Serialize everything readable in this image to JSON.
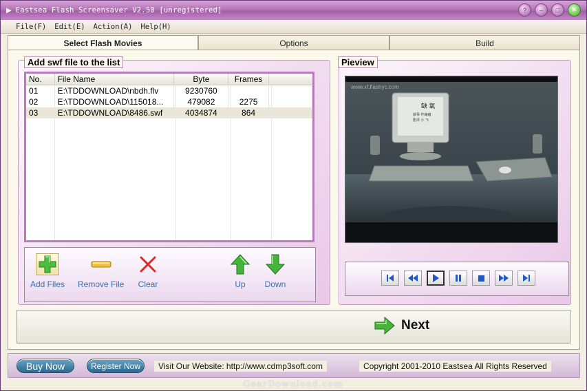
{
  "window": {
    "title": "Eastsea Flash Screensaver V2.50 [unregistered]"
  },
  "menu": {
    "items": [
      "File(F)",
      "Edit(E)",
      "Action(A)",
      "Help(H)"
    ]
  },
  "tabs": [
    {
      "label": "Select Flash Movies",
      "active": true
    },
    {
      "label": "Options",
      "active": false
    },
    {
      "label": "Build",
      "active": false
    }
  ],
  "file_panel": {
    "caption": "Add swf file to the list",
    "columns": [
      "No.",
      "File Name",
      "Byte",
      "Frames"
    ],
    "rows": [
      {
        "no": "01",
        "name": "E:\\TDDOWNLOAD\\nbdh.flv",
        "byte": "9230760",
        "frames": ""
      },
      {
        "no": "02",
        "name": "E:\\TDDOWNLOAD\\115018...",
        "byte": "479082",
        "frames": "2275"
      },
      {
        "no": "03",
        "name": "E:\\TDDOWNLOAD\\8486.swf",
        "byte": "4034874",
        "frames": "864"
      }
    ]
  },
  "toolbar": {
    "add_files": "Add Files",
    "remove_file": "Remove File",
    "clear": "Clear",
    "up": "Up",
    "down": "Down"
  },
  "preview": {
    "caption": "Pieview",
    "watermark_text": "www.xf.flashyc.com",
    "screen_title": "缺   氧",
    "screen_line1": "叙事   作曲编",
    "screen_line2": "剧评   小  飞"
  },
  "player_controls": [
    "first",
    "rewind",
    "play",
    "pause",
    "stop",
    "forward",
    "last"
  ],
  "next": {
    "label": "Next"
  },
  "footer": {
    "buy_now": "Buy Now",
    "register_now": "Register Now",
    "website": "Visit Our Website: http://www.cdmp3soft.com",
    "copyright": "Copyright 2001-2010 Eastsea All Rights Reserved"
  },
  "site_watermark": "GearDownload.com",
  "colors": {
    "title_bar": "#b575b8",
    "accent_purple": "#b77cba",
    "link_blue": "#3a6fb0",
    "green_arrow": "#3fa83a",
    "nav_blue": "#1f56c8"
  }
}
